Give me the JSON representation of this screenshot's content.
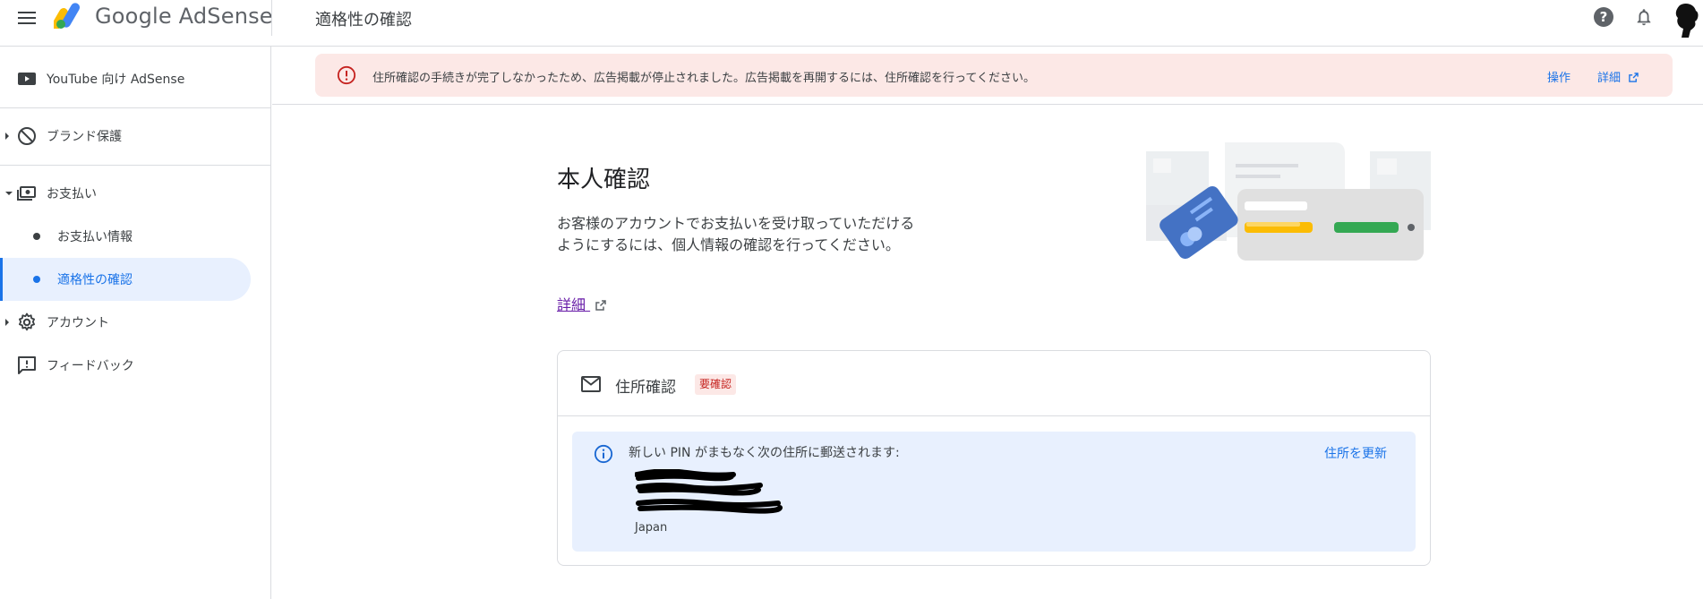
{
  "header": {
    "brand": "Google AdSense",
    "page_title": "適格性の確認",
    "help_symbol": "?",
    "icons": [
      "menu-icon",
      "adsense-logo",
      "help-icon",
      "bell-icon",
      "avatar"
    ]
  },
  "sidebar": {
    "items": [
      {
        "label": "YouTube 向け AdSense",
        "icon": "youtube-icon"
      },
      {
        "label": "ブランド保護",
        "icon": "block-icon"
      },
      {
        "label": "お支払い",
        "icon": "payments-icon"
      },
      {
        "label": "お支払い情報"
      },
      {
        "label": "適格性の確認"
      },
      {
        "label": "アカウント",
        "icon": "gear-icon"
      },
      {
        "label": "フィードバック",
        "icon": "feedback-icon"
      }
    ]
  },
  "alert": {
    "text": "住所確認の手続きが完了しなかったため、広告掲載が停止されました。広告掲載を再開するには、住所確認を行ってください。",
    "action_label": "操作",
    "details_label": "詳細"
  },
  "main": {
    "title": "本人確認",
    "description": "お客様のアカウントでお支払いを受け取っていただけるようにするには、個人情報の確認を行ってください。",
    "details_link": "詳細"
  },
  "card": {
    "title": "住所確認",
    "badge": "要確認",
    "info_text": "新しい PIN がまもなく次の住所に郵送されます:",
    "update_label": "住所を更新",
    "country": "Japan"
  },
  "colors": {
    "accent": "#1a73e8",
    "alert_bg": "#fce8e6",
    "error": "#c5221f",
    "info_bg": "#e8f0fe",
    "visited_link": "#681da8"
  }
}
